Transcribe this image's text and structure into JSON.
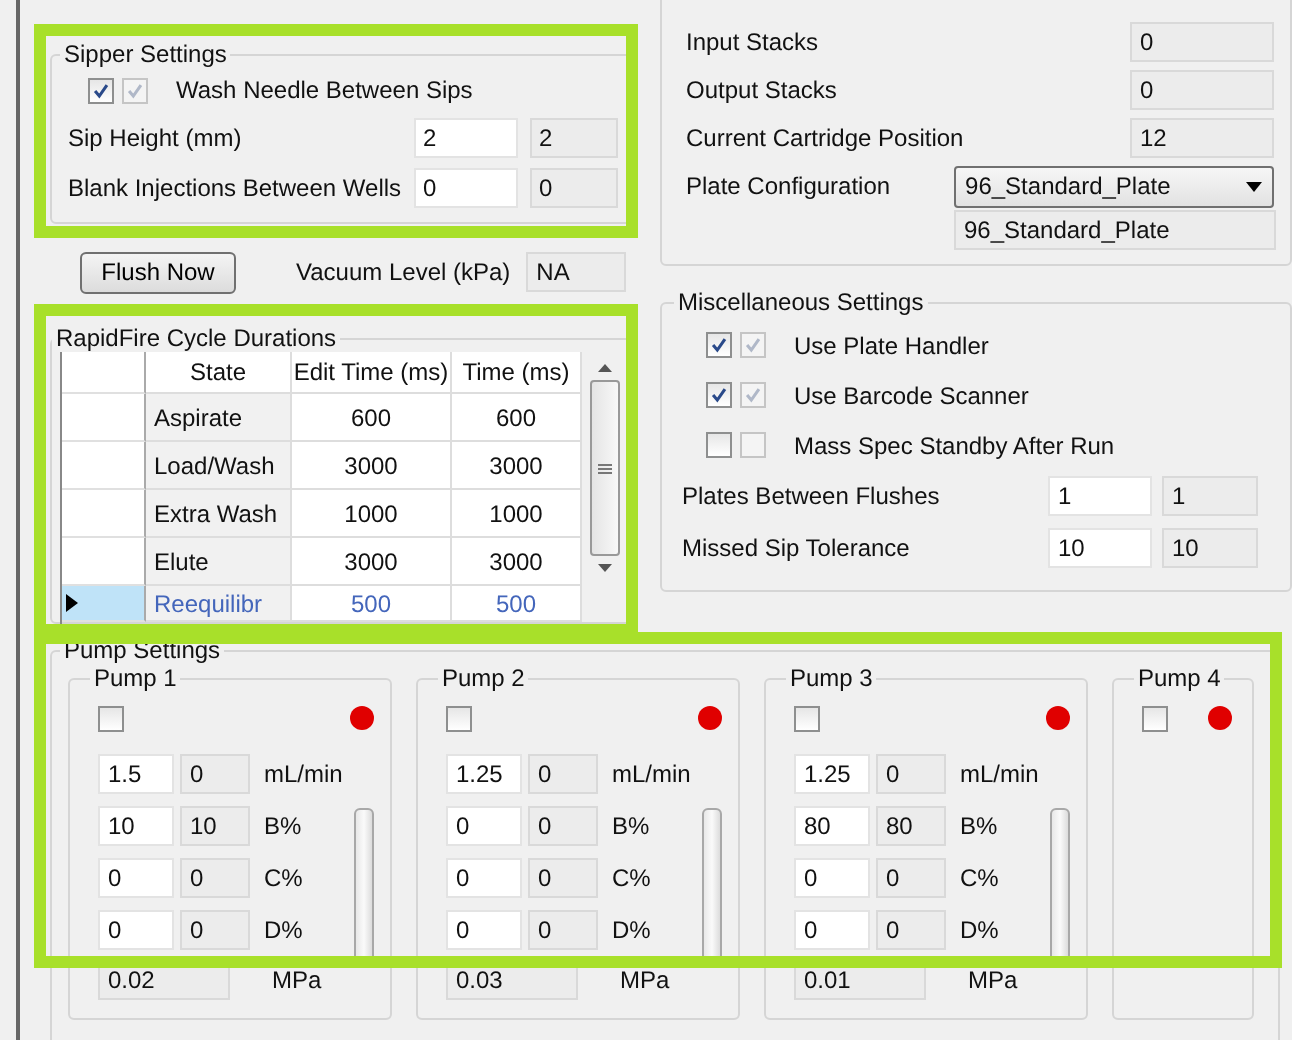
{
  "sipper_settings": {
    "title": "Sipper Settings",
    "wash_needle": {
      "label": "Wash Needle Between Sips",
      "checked": true,
      "applied_checked": true
    },
    "fields": [
      {
        "label": "Sip Height (mm)",
        "value": "2",
        "current": "2"
      },
      {
        "label": "Blank Injections Between Wells",
        "value": "0",
        "current": "0"
      }
    ]
  },
  "flush_button": "Flush Now",
  "vacuum": {
    "label": "Vacuum Level (kPa)",
    "value": "NA"
  },
  "cycle_durations": {
    "title": "RapidFire Cycle Durations",
    "columns": [
      "State",
      "Edit Time (ms)",
      "Time (ms)"
    ],
    "rows": [
      {
        "state": "Aspirate",
        "edit_time": "600",
        "time": "600",
        "selected": false
      },
      {
        "state": "Load/Wash",
        "edit_time": "3000",
        "time": "3000",
        "selected": false
      },
      {
        "state": "Extra Wash",
        "edit_time": "1000",
        "time": "1000",
        "selected": false
      },
      {
        "state": "Elute",
        "edit_time": "3000",
        "time": "3000",
        "selected": false
      },
      {
        "state": "Reequilibr",
        "edit_time": "500",
        "time": "500",
        "selected": true
      }
    ]
  },
  "stacks": [
    {
      "label": "Input Stacks",
      "value": "0"
    },
    {
      "label": "Output Stacks",
      "value": "0"
    },
    {
      "label": "Current Cartridge Position",
      "value": "12"
    }
  ],
  "plate_configuration": {
    "label": "Plate Configuration",
    "value": "96_Standard_Plate",
    "current": "96_Standard_Plate"
  },
  "misc_settings": {
    "title": "Miscellaneous Settings",
    "options": [
      {
        "label": "Use Plate Handler",
        "checked": true,
        "applied_checked": true
      },
      {
        "label": "Use Barcode Scanner",
        "checked": true,
        "applied_checked": true
      },
      {
        "label": "Mass Spec Standby After Run",
        "checked": false,
        "applied_checked": false
      }
    ],
    "fields": [
      {
        "label": "Plates Between Flushes",
        "value": "1",
        "current": "1"
      },
      {
        "label": "Missed Sip Tolerance",
        "value": "10",
        "current": "10"
      }
    ]
  },
  "pump_settings": {
    "title": "Pump Settings",
    "pumps": [
      {
        "title": "Pump 1",
        "enabled": false,
        "color": "#e00000",
        "rows": [
          {
            "value": "1.5",
            "current": "0",
            "unit": "mL/min"
          },
          {
            "value": "10",
            "current": "10",
            "unit": "B%"
          },
          {
            "value": "0",
            "current": "0",
            "unit": "C%"
          },
          {
            "value": "0",
            "current": "0",
            "unit": "D%"
          }
        ],
        "pressure": "0.02",
        "pressure_unit": "MPa"
      },
      {
        "title": "Pump 2",
        "enabled": false,
        "color": "#e00000",
        "rows": [
          {
            "value": "1.25",
            "current": "0",
            "unit": "mL/min"
          },
          {
            "value": "0",
            "current": "0",
            "unit": "B%"
          },
          {
            "value": "0",
            "current": "0",
            "unit": "C%"
          },
          {
            "value": "0",
            "current": "0",
            "unit": "D%"
          }
        ],
        "pressure": "0.03",
        "pressure_unit": "MPa"
      },
      {
        "title": "Pump 3",
        "enabled": false,
        "color": "#e00000",
        "rows": [
          {
            "value": "1.25",
            "current": "0",
            "unit": "mL/min"
          },
          {
            "value": "80",
            "current": "80",
            "unit": "B%"
          },
          {
            "value": "0",
            "current": "0",
            "unit": "C%"
          },
          {
            "value": "0",
            "current": "0",
            "unit": "D%"
          }
        ],
        "pressure": "0.01",
        "pressure_unit": "MPa"
      },
      {
        "title": "Pump 4",
        "enabled": false,
        "color": "#e00000"
      }
    ]
  }
}
